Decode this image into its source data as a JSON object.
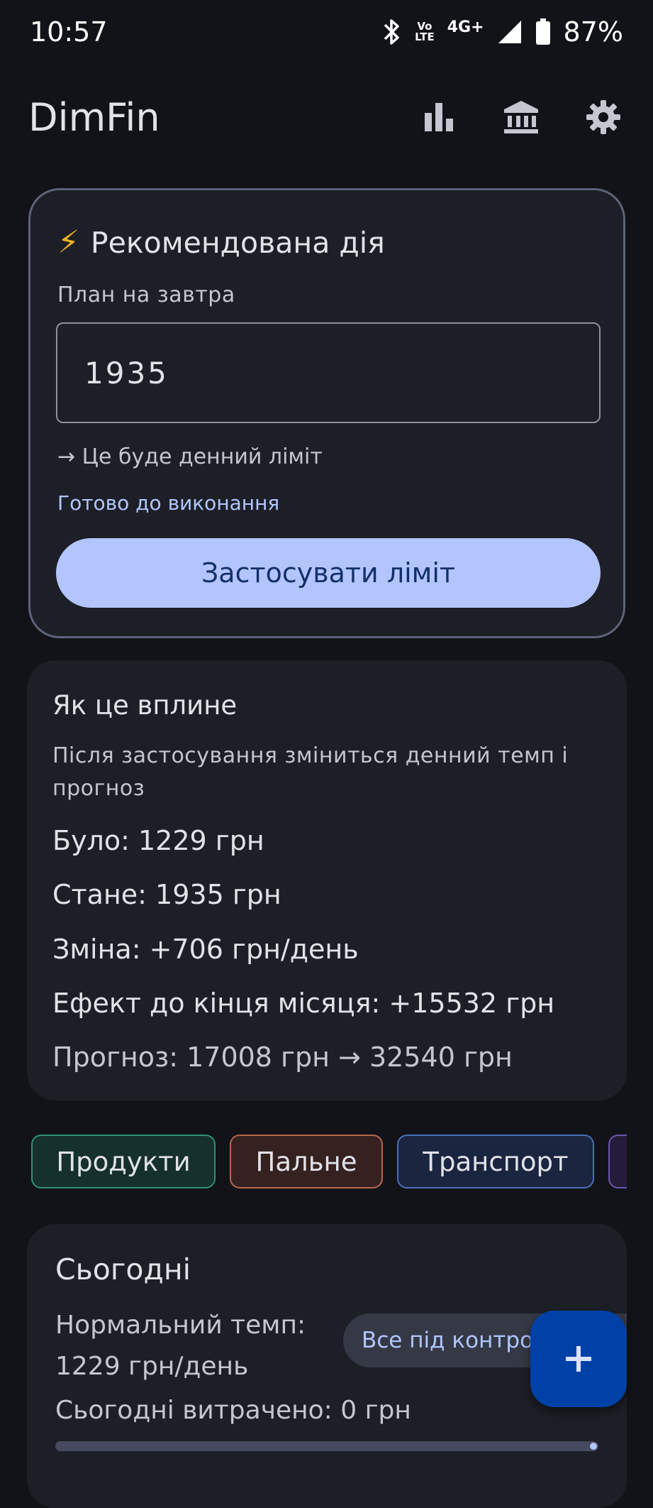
{
  "status_bar": {
    "time": "10:57",
    "volte_top": "Vo",
    "volte_bottom": "LTE",
    "network": "4G+",
    "battery": "87%"
  },
  "app_bar": {
    "title": "DimFin",
    "icons": [
      "bar-chart-icon",
      "bank-icon",
      "gear-icon"
    ]
  },
  "recommended": {
    "icon": "⚡",
    "title": "Рекомендована дія",
    "field_label": "План на завтра",
    "field_value": "1935",
    "hint": "→ Це буде денний ліміт",
    "status": "Готово до виконання",
    "button": "Застосувати ліміт"
  },
  "impact": {
    "title": "Як це вплине",
    "description": "Після застосування зміниться денний темп і прогноз",
    "was": "Було: 1229 грн",
    "will_be": "Стане: 1935 грн",
    "change": "Зміна: +706 грн/день",
    "effect": "Ефект до кінця місяця: +15532 грн",
    "forecast": "Прогноз: 17008 грн → 32540 грн"
  },
  "categories": [
    {
      "label": "Продукти",
      "border": "#2f8f7a",
      "bg": "#15302d"
    },
    {
      "label": "Пальне",
      "border": "#b8664d",
      "bg": "#352220"
    },
    {
      "label": "Транспорт",
      "border": "#4a70b8",
      "bg": "#1a2540"
    },
    {
      "label": "",
      "border": "#6a55b0",
      "bg": "#241d3a"
    }
  ],
  "today": {
    "title": "Сьогодні",
    "tempo_line1": "Нормальний темп:",
    "tempo_line2": "1229 грн/день",
    "status_pill": "Все під контролем",
    "spent": "Сьогодні витрачено: 0 грн",
    "progress": 0.0
  },
  "fab": {
    "icon": "plus-icon"
  }
}
